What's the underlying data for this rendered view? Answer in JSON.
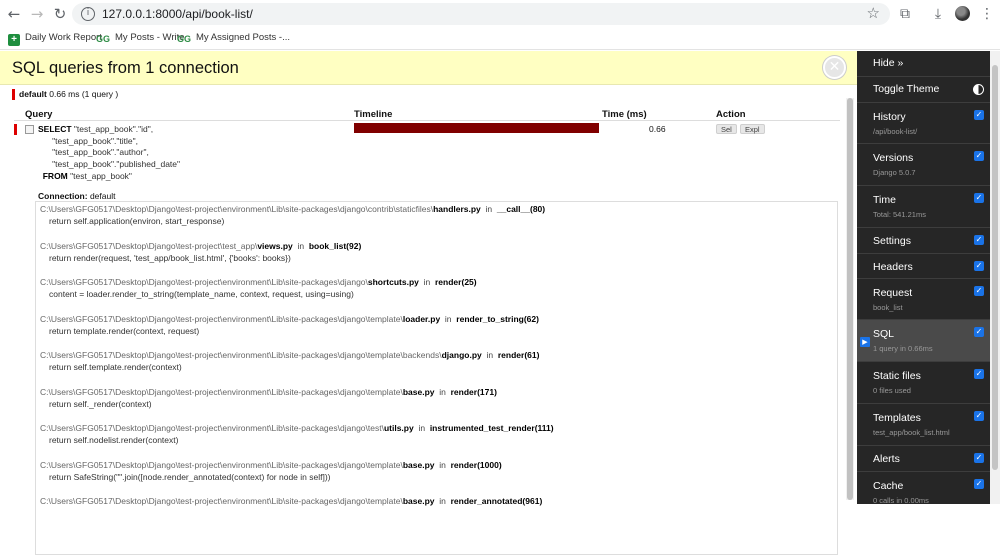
{
  "browser": {
    "url": "127.0.0.1:8000/api/book-list/",
    "bookmarks": [
      "Daily Work Report",
      "My Posts - Write",
      "My Assigned Posts -..."
    ]
  },
  "panel": {
    "title": "SQL queries from 1 connection",
    "db_alias": "default",
    "db_summary": "0.66 ms (1 query )",
    "columns": [
      "Query",
      "Timeline",
      "Time (ms)",
      "Action"
    ],
    "query": {
      "select_kw": "SELECT",
      "lines": [
        "\"test_app_book\".\"id\",",
        "      \"test_app_book\".\"title\",",
        "      \"test_app_book\".\"author\",",
        "      \"test_app_book\".\"published_date\""
      ],
      "from_kw": "FROM",
      "from_table": "\"test_app_book\"",
      "time_ms": "0.66",
      "timeline_fraction": 1.0,
      "actions": [
        "Sel",
        "Expl"
      ]
    },
    "connection_label": "Connection:",
    "connection_value": "default",
    "stack": [
      {
        "path": "C:\\Users\\GFG0517\\Desktop\\Django\\test-project\\environment\\Lib\\site-packages\\django\\contrib\\staticfiles\\",
        "file": "handlers.py",
        "in": "in",
        "fn": "__call__",
        "line": "80",
        "code": "return self.application(environ, start_response)"
      },
      {
        "path": "C:\\Users\\GFG0517\\Desktop\\Django\\test-project\\test_app\\",
        "file": "views.py",
        "in": "in",
        "fn": "book_list",
        "line": "92",
        "code": "return render(request, 'test_app/book_list.html', {'books': books})"
      },
      {
        "path": "C:\\Users\\GFG0517\\Desktop\\Django\\test-project\\environment\\Lib\\site-packages\\django\\",
        "file": "shortcuts.py",
        "in": "in",
        "fn": "render",
        "line": "25",
        "code": "content = loader.render_to_string(template_name, context, request, using=using)"
      },
      {
        "path": "C:\\Users\\GFG0517\\Desktop\\Django\\test-project\\environment\\Lib\\site-packages\\django\\template\\",
        "file": "loader.py",
        "in": "in",
        "fn": "render_to_string",
        "line": "62",
        "code": "return template.render(context, request)"
      },
      {
        "path": "C:\\Users\\GFG0517\\Desktop\\Django\\test-project\\environment\\Lib\\site-packages\\django\\template\\backends\\",
        "file": "django.py",
        "in": "in",
        "fn": "render",
        "line": "61",
        "code": "return self.template.render(context)"
      },
      {
        "path": "C:\\Users\\GFG0517\\Desktop\\Django\\test-project\\environment\\Lib\\site-packages\\django\\template\\",
        "file": "base.py",
        "in": "in",
        "fn": "render",
        "line": "171",
        "code": "return self._render(context)"
      },
      {
        "path": "C:\\Users\\GFG0517\\Desktop\\Django\\test-project\\environment\\Lib\\site-packages\\django\\test\\",
        "file": "utils.py",
        "in": "in",
        "fn": "instrumented_test_render",
        "line": "111",
        "code": "return self.nodelist.render(context)"
      },
      {
        "path": "C:\\Users\\GFG0517\\Desktop\\Django\\test-project\\environment\\Lib\\site-packages\\django\\template\\",
        "file": "base.py",
        "in": "in",
        "fn": "render",
        "line": "1000",
        "code": "return SafeString(\"\".join([node.render_annotated(context) for node in self]))"
      },
      {
        "path": "C:\\Users\\GFG0517\\Desktop\\Django\\test-project\\environment\\Lib\\site-packages\\django\\template\\",
        "file": "base.py",
        "in": "in",
        "fn": "render_annotated",
        "line": "961",
        "code": ""
      }
    ]
  },
  "toolbar": {
    "hide": "Hide »",
    "toggle_theme": "Toggle Theme",
    "items": [
      {
        "title": "History",
        "sub": "/api/book-list/"
      },
      {
        "title": "Versions",
        "sub": "Django 5.0.7"
      },
      {
        "title": "Time",
        "sub": "Total: 541.21ms"
      },
      {
        "title": "Settings",
        "sub": ""
      },
      {
        "title": "Headers",
        "sub": ""
      },
      {
        "title": "Request",
        "sub": "book_list"
      },
      {
        "title": "SQL",
        "sub": "1 query in 0.66ms"
      },
      {
        "title": "Static files",
        "sub": "0 files used"
      },
      {
        "title": "Templates",
        "sub": "test_app/book_list.html"
      },
      {
        "title": "Alerts",
        "sub": ""
      },
      {
        "title": "Cache",
        "sub": "0 calls in 0.00ms"
      }
    ]
  }
}
